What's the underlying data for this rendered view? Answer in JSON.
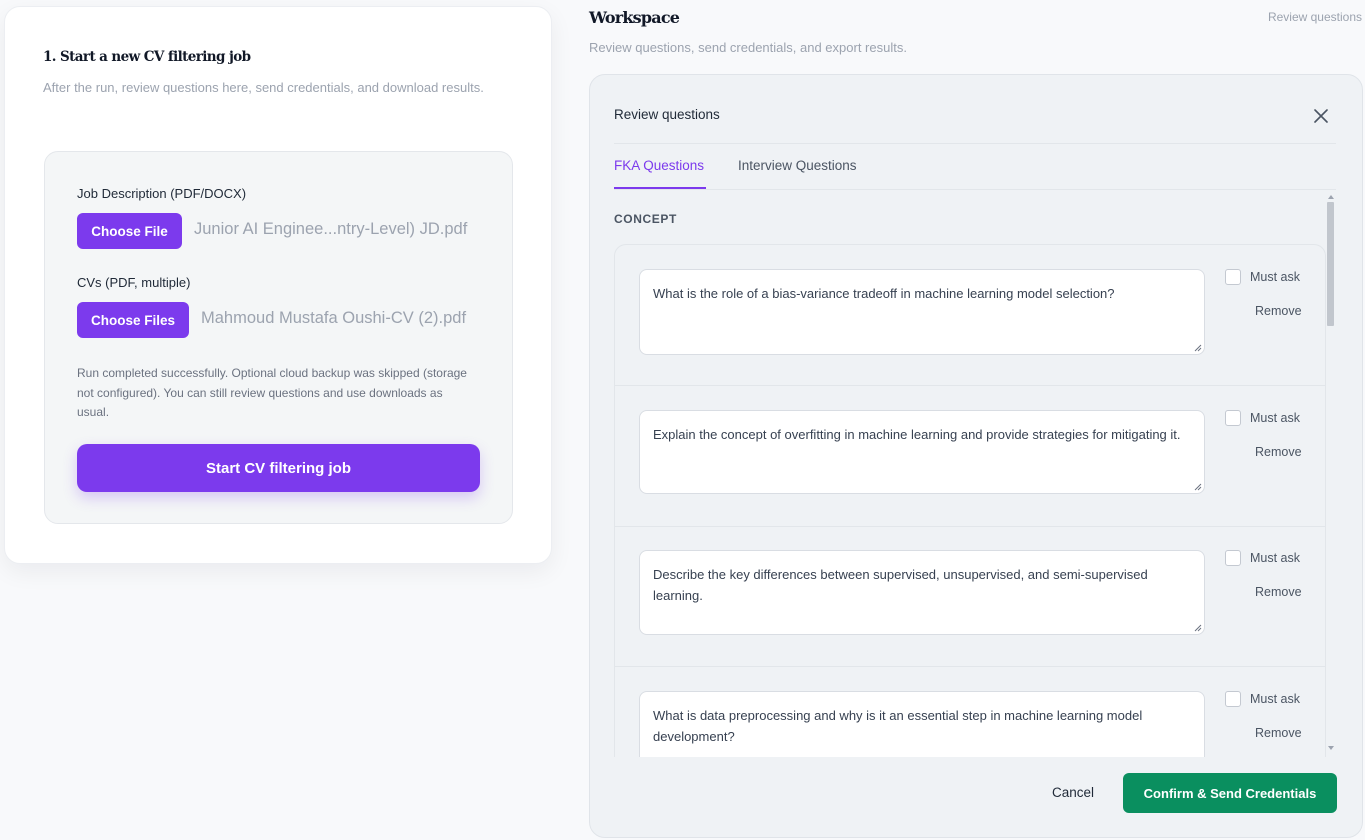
{
  "left_panel": {
    "title": "1. Start a new CV filtering job",
    "description": "After the run, review questions here, send credentials, and download results.",
    "job_description": {
      "label": "Job Description (PDF/DOCX)",
      "button": "Choose File",
      "file_name": "Junior AI Enginee...ntry-Level) JD.pdf"
    },
    "cvs": {
      "label": "CVs (PDF, multiple)",
      "button": "Choose Files",
      "file_name": "Mahmoud Mustafa Oushi-CV (2).pdf"
    },
    "status": "Run completed successfully. Optional cloud backup was skipped (storage not configured). You can still review questions and use downloads as usual.",
    "start_button": "Start CV filtering job"
  },
  "workspace": {
    "title": "Workspace",
    "subtitle": "Review questions, send credentials, and export results.",
    "link": "Review questions"
  },
  "modal": {
    "title": "Review questions",
    "close_icon": "close-icon",
    "tabs": [
      {
        "label": "FKA Questions",
        "active": true
      },
      {
        "label": "Interview Questions",
        "active": false
      }
    ],
    "section": "CONCEPT",
    "must_ask_label": "Must ask",
    "remove_label": "Remove",
    "questions": [
      {
        "text": "What is the role of a bias-variance tradeoff in machine learning model selection?",
        "must_ask": false
      },
      {
        "text": "Explain the concept of overfitting in machine learning and provide strategies for mitigating it.",
        "must_ask": false
      },
      {
        "text": "Describe the key differences between supervised, unsupervised, and semi-supervised learning.",
        "must_ask": false
      },
      {
        "text": "What is data preprocessing and why is it an essential step in machine learning model development?",
        "must_ask": false
      }
    ],
    "cancel": "Cancel",
    "confirm": "Confirm & Send Credentials"
  },
  "colors": {
    "accent": "#7c3aed",
    "confirm": "#0a8f5f"
  }
}
